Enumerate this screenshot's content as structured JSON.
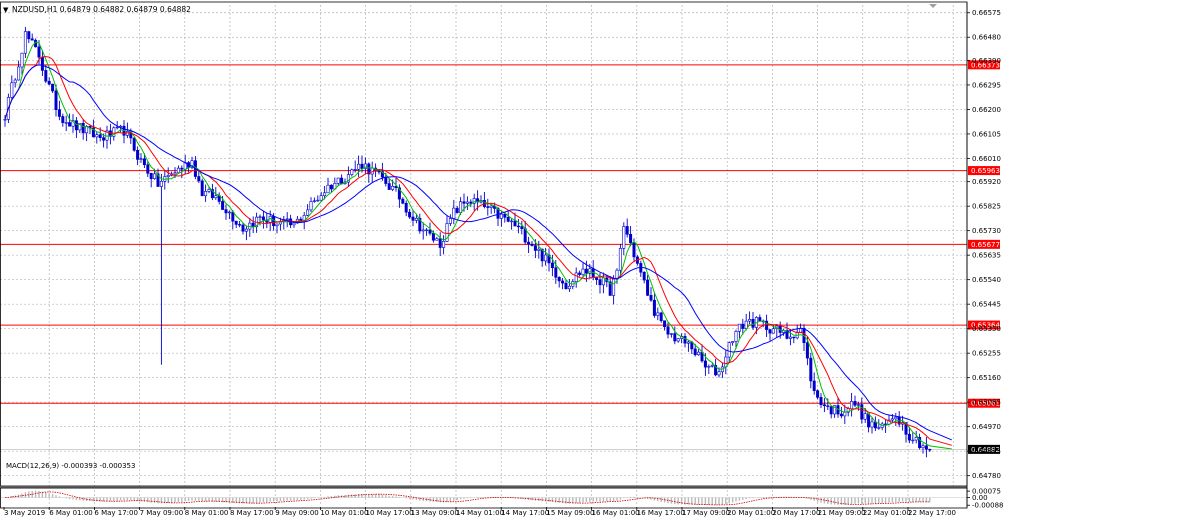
{
  "chart_data": {
    "type": "candlestick",
    "symbol_line": "NZDUSD,H1  0.64879 0.64882 0.64879 0.64882",
    "main": {
      "ylim": [
        0.6474,
        0.66605
      ],
      "y_ticks": [
        "0.66575",
        "0.66480",
        "0.66390",
        "0.66295",
        "0.66200",
        "0.66105",
        "0.66010",
        "0.65920",
        "0.65825",
        "0.65730",
        "0.65635",
        "0.65540",
        "0.65445",
        "0.65350",
        "0.65255",
        "0.65160",
        "0.65065",
        "0.64970",
        "0.64875",
        "0.64780"
      ],
      "x_labels": [
        "3 May 2019",
        "6 May 01:00",
        "6 May 17:00",
        "7 May 09:00",
        "8 May 01:00",
        "8 May 17:00",
        "9 May 09:00",
        "10 May 01:00",
        "10 May 17:00",
        "13 May 09:00",
        "14 May 01:00",
        "14 May 17:00",
        "15 May 09:00",
        "16 May 01:00",
        "16 May 17:00",
        "17 May 09:00",
        "20 May 01:00",
        "20 May 17:00",
        "21 May 09:00",
        "22 May 01:00",
        "22 May 17:00"
      ],
      "levels": [
        {
          "value": 0.66373,
          "label": "0.66373"
        },
        {
          "value": 0.65963,
          "label": "0.65963"
        },
        {
          "value": 0.65677,
          "label": "0.65677"
        },
        {
          "value": 0.65364,
          "label": "0.65364"
        },
        {
          "value": 0.65061,
          "label": "0.65061"
        }
      ],
      "last_price": {
        "value": 0.64882,
        "label": "0.64882"
      },
      "anchors": [
        [
          0,
          0.6618
        ],
        [
          6,
          0.6649
        ],
        [
          10,
          0.6641
        ],
        [
          12,
          0.6632
        ],
        [
          16,
          0.6618
        ],
        [
          20,
          0.6614
        ],
        [
          28,
          0.6609
        ],
        [
          35,
          0.6612
        ],
        [
          40,
          0.66
        ],
        [
          45,
          0.6591
        ],
        [
          50,
          0.6596
        ],
        [
          55,
          0.66
        ],
        [
          58,
          0.6588
        ],
        [
          62,
          0.6586
        ],
        [
          66,
          0.658
        ],
        [
          70,
          0.6574
        ],
        [
          75,
          0.6578
        ],
        [
          80,
          0.6576
        ],
        [
          85,
          0.6575
        ],
        [
          90,
          0.6583
        ],
        [
          95,
          0.659
        ],
        [
          100,
          0.6594
        ],
        [
          105,
          0.6599
        ],
        [
          108,
          0.6596
        ],
        [
          112,
          0.6592
        ],
        [
          116,
          0.6586
        ],
        [
          120,
          0.6578
        ],
        [
          124,
          0.6572
        ],
        [
          128,
          0.6568
        ],
        [
          132,
          0.658
        ],
        [
          136,
          0.6585
        ],
        [
          140,
          0.6583
        ],
        [
          145,
          0.6579
        ],
        [
          150,
          0.6575
        ],
        [
          155,
          0.6568
        ],
        [
          160,
          0.656
        ],
        [
          165,
          0.6552
        ],
        [
          170,
          0.6558
        ],
        [
          174,
          0.6555
        ],
        [
          178,
          0.655
        ],
        [
          180,
          0.6556
        ],
        [
          182,
          0.6575
        ],
        [
          184,
          0.6568
        ],
        [
          186,
          0.656
        ],
        [
          190,
          0.6545
        ],
        [
          194,
          0.6534
        ],
        [
          198,
          0.6531
        ],
        [
          202,
          0.6528
        ],
        [
          206,
          0.652
        ],
        [
          210,
          0.6518
        ],
        [
          214,
          0.6532
        ],
        [
          218,
          0.6538
        ],
        [
          222,
          0.6537
        ],
        [
          226,
          0.6535
        ],
        [
          230,
          0.6532
        ],
        [
          234,
          0.6535
        ],
        [
          238,
          0.651
        ],
        [
          242,
          0.6504
        ],
        [
          246,
          0.6503
        ],
        [
          250,
          0.6506
        ],
        [
          254,
          0.6498
        ],
        [
          258,
          0.6496
        ],
        [
          262,
          0.6502
        ],
        [
          266,
          0.6494
        ],
        [
          270,
          0.649
        ],
        [
          272,
          0.6487
        ]
      ],
      "spikes": [
        {
          "bar": 46,
          "low": 0.6521
        }
      ],
      "ma_periods": [
        5,
        10,
        20
      ],
      "ma_colors": [
        "#00c000",
        "#ff0000",
        "#0000ff"
      ],
      "candle_color": "#0000cc",
      "level_color": "#ff0000",
      "grid_color": "#b4b4b4"
    },
    "macd": {
      "label": "MACD(12,26,9) -0.000393 -0.000353",
      "ylim": [
        -0.00097,
        0.00088
      ],
      "y_ticks": [
        "0.00075",
        "0.00",
        "-0.00088"
      ],
      "hist_color": "#b8b8b8",
      "signal_color": "#cc0000"
    }
  }
}
